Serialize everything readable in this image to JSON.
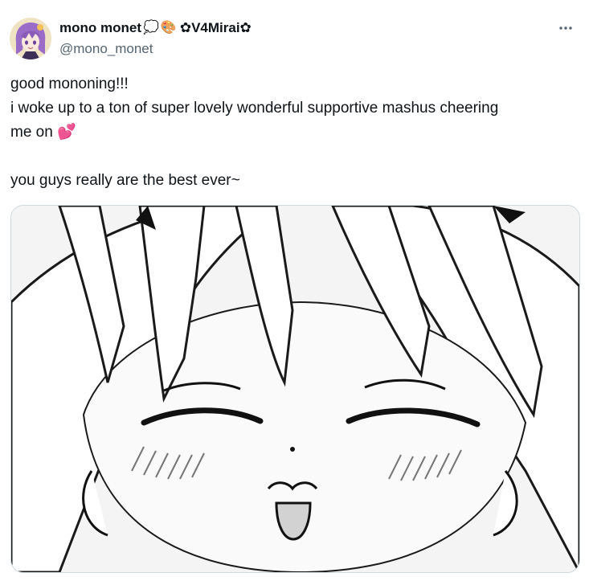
{
  "author": {
    "display_name": "mono monet",
    "display_name_suffix": "✿V4Mirai✿",
    "emojis": [
      "💭",
      "🎨"
    ],
    "handle": "@mono_monet",
    "avatar_icon": "avatar-anime-purple-hair"
  },
  "menu": {
    "more_icon": "more-horizontal-icon"
  },
  "post": {
    "lines": [
      "good mononing!!!",
      "i woke up to a ton of super lovely wonderful supportive mashus cheering",
      "me on"
    ],
    "line3_emoji": "💕",
    "closing": "you guys really are the best ever~"
  },
  "media": {
    "description_icon": "manga-smiling-face-image"
  },
  "colors": {
    "text_primary": "#0f1419",
    "text_secondary": "#536471",
    "border": "#cfd9de"
  }
}
